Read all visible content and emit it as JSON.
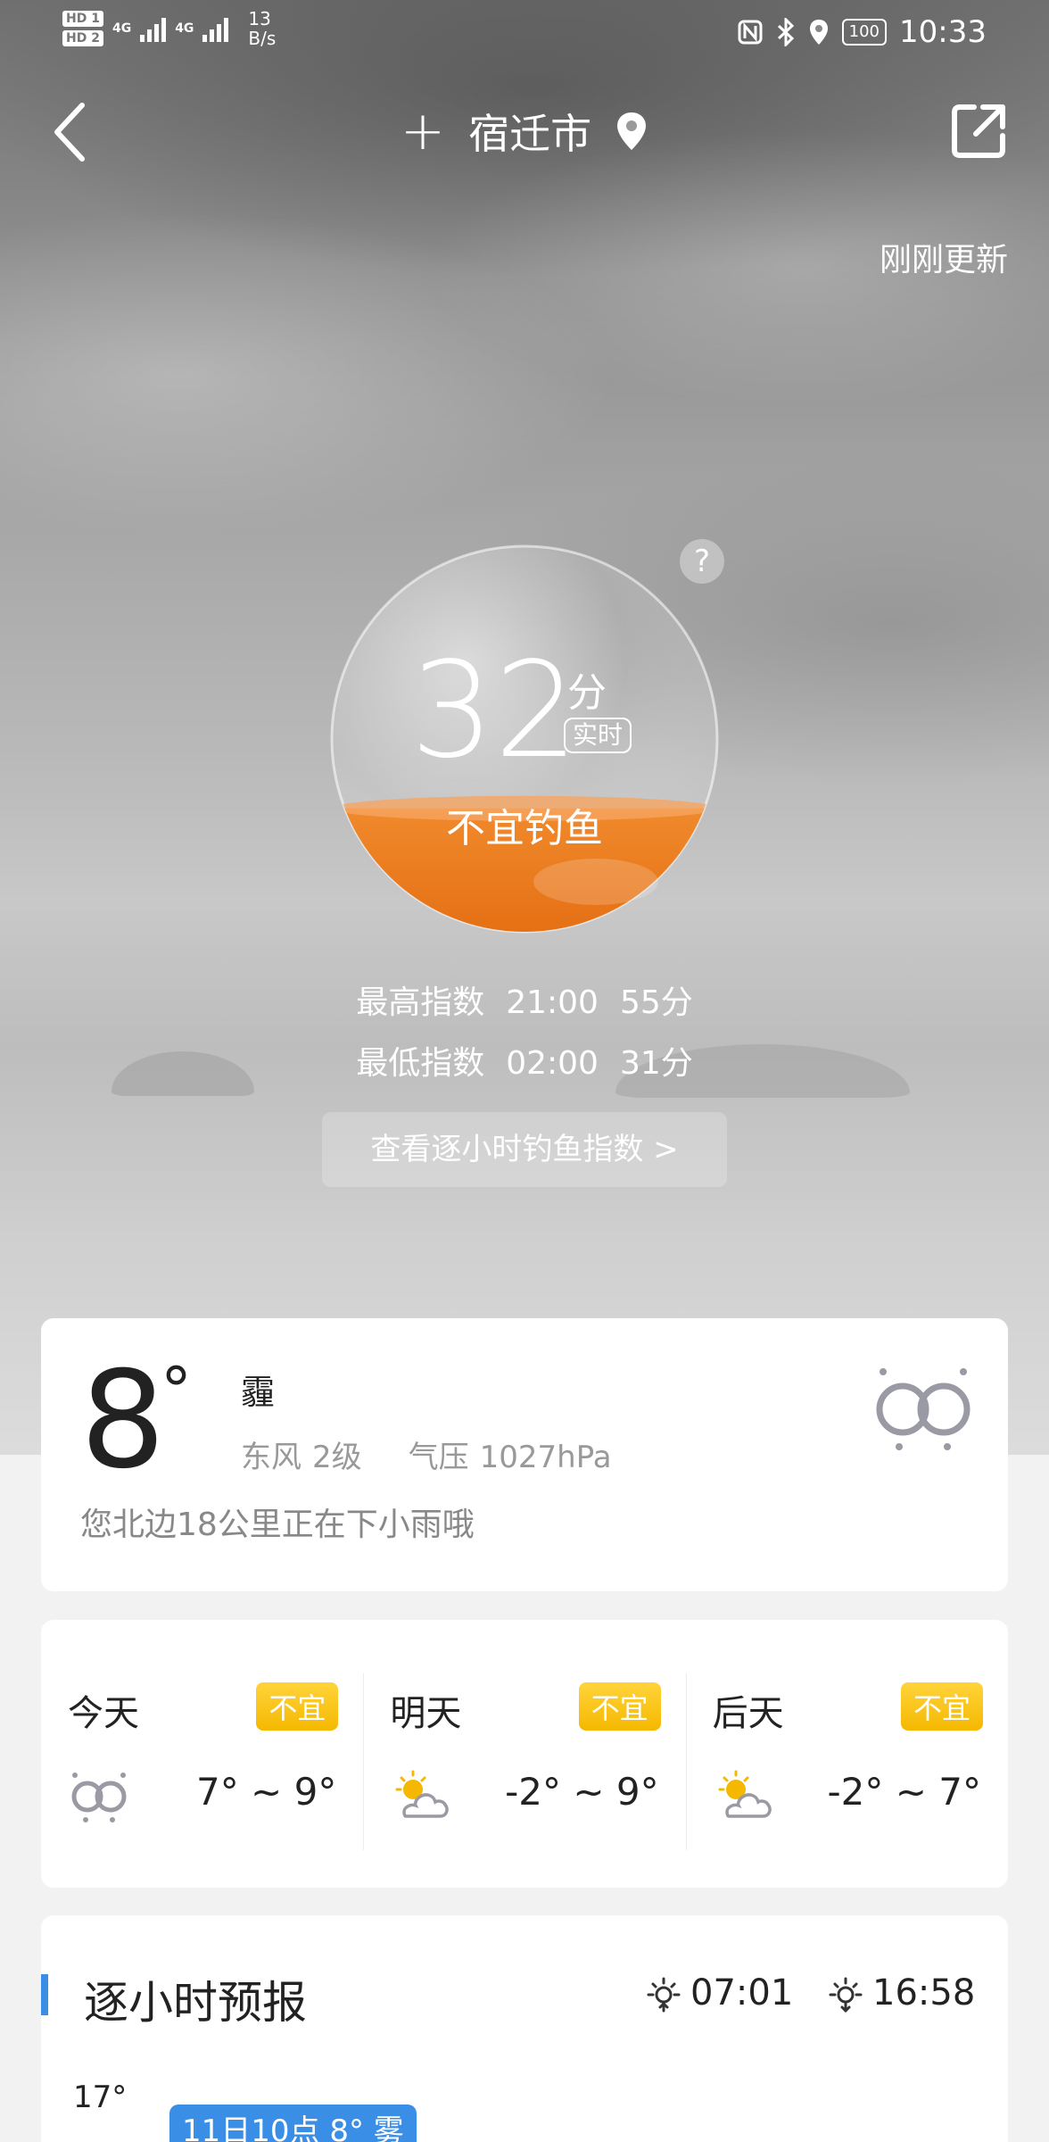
{
  "status_bar": {
    "hd1": "HD 1",
    "hd2": "HD 2",
    "network": "4G",
    "net_speed_value": "13",
    "net_speed_unit": "B/s",
    "battery": "100",
    "time": "10:33"
  },
  "header": {
    "add_icon": "+",
    "city": "宿迁市"
  },
  "updated_text": "刚刚更新",
  "fishing": {
    "score": "32",
    "unit": "分",
    "realtime_tag": "实时",
    "verdict": "不宜钓鱼",
    "help": "?",
    "fill_fraction": 0.32,
    "highest": {
      "label": "最高指数",
      "time": "21:00",
      "score": "55分"
    },
    "lowest": {
      "label": "最低指数",
      "time": "02:00",
      "score": "31分"
    },
    "hourly_button": "查看逐小时钓鱼指数 >"
  },
  "current": {
    "temp": "8",
    "degree": "°",
    "condition": "霾",
    "wind_dir": "东风",
    "wind_level": "2级",
    "pressure_label": "气压",
    "pressure_value": "1027hPa",
    "rain_note": "您北边18公里正在下小雨哦",
    "icon": "haze-icon"
  },
  "days": [
    {
      "name": "今天",
      "badge": "不宜",
      "icon": "haze-icon",
      "range": "7° ~ 9°"
    },
    {
      "name": "明天",
      "badge": "不宜",
      "icon": "partly-cloudy-icon",
      "range": "-2° ~ 9°"
    },
    {
      "name": "后天",
      "badge": "不宜",
      "icon": "partly-cloudy-icon",
      "range": "-2° ~ 7°"
    }
  ],
  "hourly": {
    "title": "逐小时预报",
    "sunrise": "07:01",
    "sunset": "16:58",
    "peak_temp": "17°",
    "selected_tag": "11日10点 8° 雾"
  },
  "colors": {
    "accent_blue": "#3a8ee6",
    "badge_yellow": "#f5b800",
    "gauge_orange": "#ee7d22"
  }
}
